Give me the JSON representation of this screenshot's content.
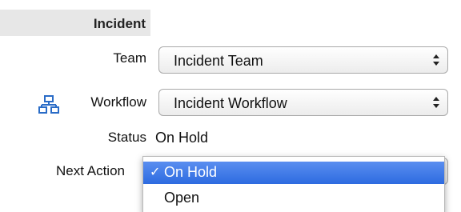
{
  "section": {
    "title": "Incident"
  },
  "fields": {
    "team": {
      "label": "Team",
      "value": "Incident Team"
    },
    "workflow": {
      "label": "Workflow",
      "value": "Incident Workflow",
      "icon": "workflow-diagram-icon"
    },
    "status": {
      "label": "Status",
      "value": "On Hold"
    },
    "next_action": {
      "label": "Next Action",
      "options": [
        {
          "label": "On Hold",
          "selected": true,
          "check": "✓"
        },
        {
          "label": "Open",
          "selected": false
        }
      ]
    }
  },
  "colors": {
    "header_band": "#e7e7e7",
    "selection_highlight": "#2d6be0",
    "workflow_icon": "#2a6cc7"
  }
}
